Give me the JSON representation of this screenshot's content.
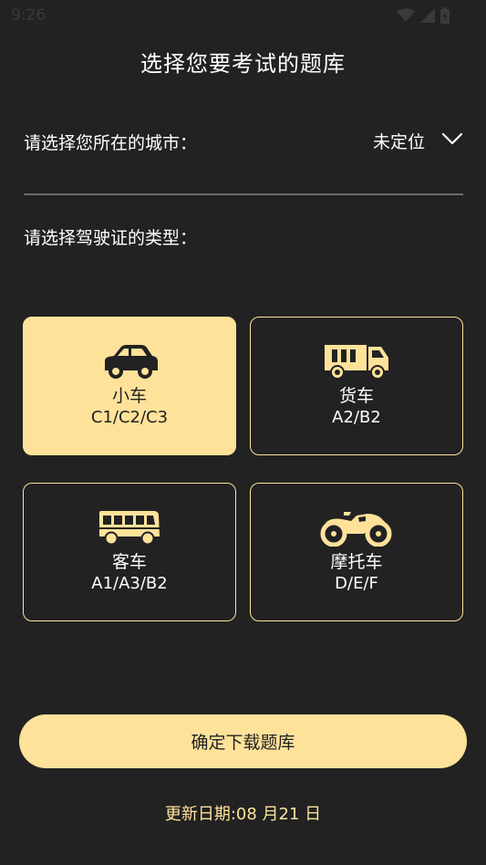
{
  "status_bar": {
    "time": "9:26"
  },
  "header": {
    "title": "选择您要考试的题库"
  },
  "city": {
    "label": "请选择您所在的城市：",
    "value": "未定位"
  },
  "license_type": {
    "label": "请选择驾驶证的类型："
  },
  "vehicles": [
    {
      "name": "小车",
      "code": "C1/C2/C3",
      "icon": "car-icon",
      "selected": true
    },
    {
      "name": "货车",
      "code": "A2/B2",
      "icon": "truck-icon",
      "selected": false
    },
    {
      "name": "客车",
      "code": "A1/A3/B2",
      "icon": "bus-icon",
      "selected": false
    },
    {
      "name": "摩托车",
      "code": "D/E/F",
      "icon": "motorcycle-icon",
      "selected": false
    }
  ],
  "confirm_button": {
    "label": "确定下载题库"
  },
  "footer": {
    "update_date": "更新日期:08 月21 日"
  },
  "colors": {
    "background": "#222222",
    "accent": "#ffe29a",
    "text": "#ffffff",
    "divider": "#6a6a6a"
  }
}
